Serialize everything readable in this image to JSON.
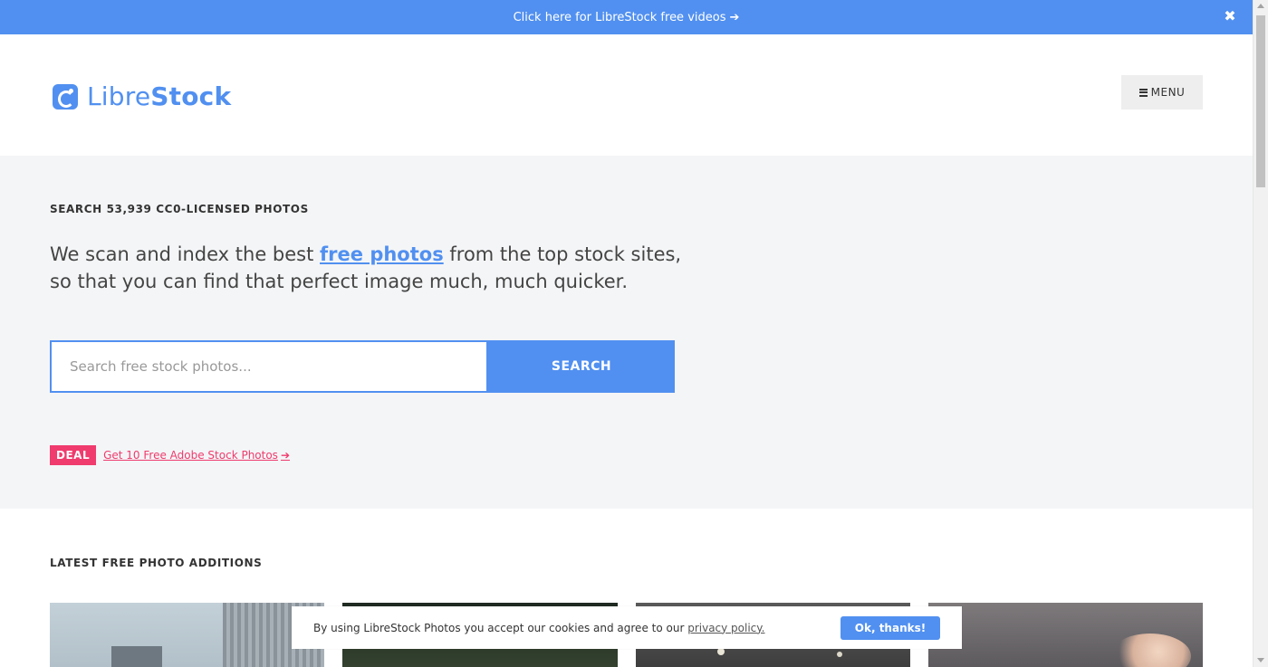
{
  "banner": {
    "text": "Click here for LibreStock free videos",
    "arrow": "➔",
    "close": "✖"
  },
  "header": {
    "logo_light": "Libre",
    "logo_bold": "Stock",
    "menu_label": "MENU",
    "logo_icon": "librestock-logo-icon",
    "menu_icon": "hamburger-icon"
  },
  "hero": {
    "eyebrow": "SEARCH 53,939 CC0-LICENSED PHOTOS",
    "tagline_before": "We scan and index the best ",
    "tagline_link": "free photos",
    "tagline_after": " from the top stock sites, so that you can find that perfect image much, much quicker.",
    "search_placeholder": "Search free stock photos...",
    "search_button": "SEARCH",
    "deal_badge": "DEAL",
    "deal_link": "Get 10 Free Adobe Stock Photos",
    "deal_arrow": "➔"
  },
  "latest": {
    "title": "LATEST FREE PHOTO ADDITIONS"
  },
  "cookie": {
    "text_before": "By using LibreStock Photos you accept our cookies and agree to our ",
    "policy_link": "privacy policy.",
    "button": "Ok, thanks!"
  },
  "colors": {
    "brand": "#5190f0",
    "deal": "#ef3b6d",
    "hero_bg": "#f4f5f7"
  }
}
